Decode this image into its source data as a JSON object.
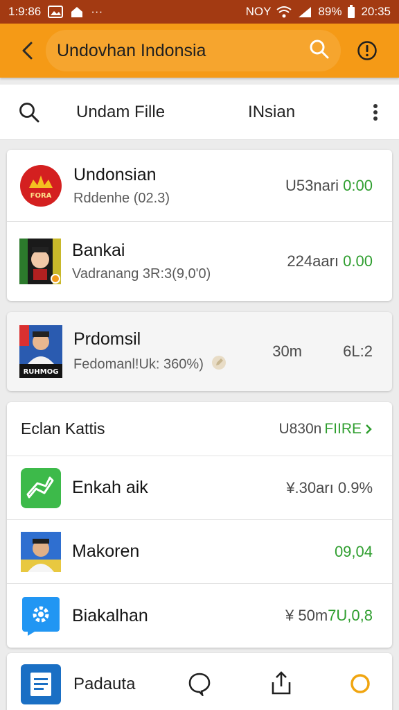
{
  "status_bar": {
    "time_left": "1:9:86",
    "network": "NOY",
    "battery": "89%",
    "time_right": "20:35"
  },
  "app_bar": {
    "search_text": "Undovhan Indonsia"
  },
  "sub_toolbar": {
    "left_label": "Undam Fille",
    "right_label": "INsian"
  },
  "card1": {
    "rows": [
      {
        "title": "Undonsian",
        "subtitle": "Rddenhe (02.3)",
        "value": "U53nari",
        "change": "0:00",
        "logo_text": "FORA"
      },
      {
        "title": "Bankai",
        "subtitle": "Vadranang 3R:3(9,0'0)",
        "value": "224aarı",
        "change": "0.00"
      }
    ]
  },
  "card2": {
    "title": "Prdomsil",
    "subtitle": "Fedomanl!Uk: 360%)",
    "value": "30m",
    "change": "6L:2",
    "logo_text": "RUHMOG"
  },
  "card3": {
    "header": {
      "label": "Eclan Kattis",
      "right_value": "U830n",
      "right_link": "FIIRE"
    },
    "rows": [
      {
        "title": "Enkah aik",
        "value": "¥.30arı 0.9%"
      },
      {
        "title": "Makoren",
        "value": "09,04"
      },
      {
        "title": "Biakalhan",
        "value_prefix": "¥ 50m",
        "value": "7U,0,8"
      }
    ]
  },
  "bottom": {
    "label": "Padauta"
  },
  "colors": {
    "status_bar": "#a33a12",
    "app_bar": "#f59a16",
    "accent_green": "#2f9e2f"
  }
}
